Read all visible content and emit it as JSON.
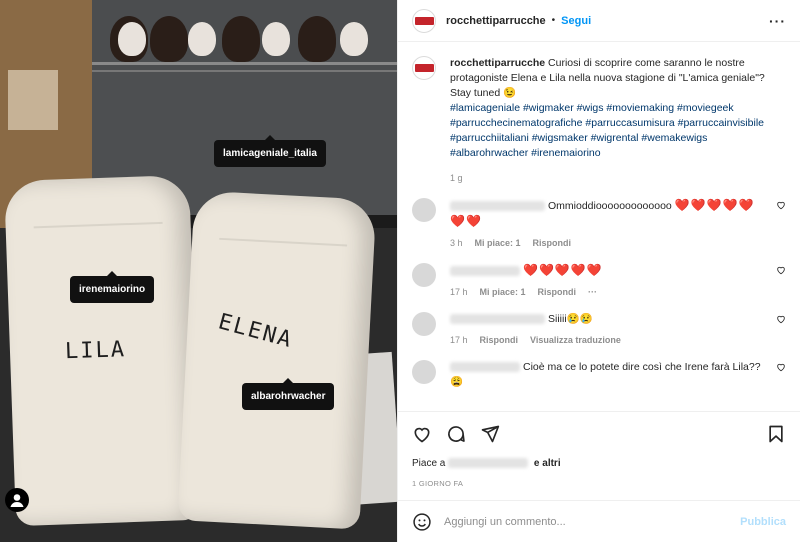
{
  "photo": {
    "tags": [
      "lamicageniale_italia",
      "irenemaiorino",
      "albarohrwacher"
    ],
    "bag_left": "LILA",
    "bag_right": "ELENA"
  },
  "header": {
    "username": "rocchettiparrucche",
    "separator": "•",
    "follow_label": "Segui",
    "more_label": "···"
  },
  "caption": {
    "username": "rocchettiparrucche",
    "text": "Curiosi di scoprire come saranno le nostre protagoniste Elena e Lila nella nuova stagione di \"L'amica geniale\"? Stay tuned 😉",
    "hashtags": "#lamicageniale #wigmaker #wigs #moviemaking #moviegeek #parrucchecinematografiche #parruccasumisura #parruccainvisibile #parrucchiitaliani #wigsmaker #wigrental #wemakewigs #albarohrwacher #irenemaiorino",
    "time": "1 g"
  },
  "comments": [
    {
      "text": "Ommioddiooooooooooooo",
      "hearts": "❤️❤️❤️❤️❤️❤️❤️",
      "time": "3 h",
      "likes": "Mi piace: 1",
      "reply": "Rispondi",
      "translate": ""
    },
    {
      "text": "",
      "hearts": "❤️❤️❤️❤️❤️",
      "time": "17 h",
      "likes": "Mi piace: 1",
      "reply": "Rispondi",
      "translate": ""
    },
    {
      "text": "Siiiii😢😢",
      "hearts": "",
      "time": "17 h",
      "likes": "",
      "reply": "Rispondi",
      "translate": "Visualizza traduzione"
    },
    {
      "text": "Cioè ma ce lo potete dire così che Irene farà Lila?? 😩",
      "hearts": "",
      "time": "",
      "likes": "",
      "reply": "",
      "translate": ""
    }
  ],
  "actions": {
    "likes_prefix": "Piace a",
    "likes_suffix": "e altri",
    "posted_ago": "1 GIORNO FA"
  },
  "add_comment": {
    "placeholder": "Aggiungi un commento...",
    "publish_label": "Pubblica"
  },
  "colors": {
    "accent": "#0095f6",
    "heart": "#e0245e",
    "hashtag": "#00376b",
    "muted": "#8e8e8e"
  },
  "icons": [
    "heart-icon",
    "comment-icon",
    "share-icon",
    "bookmark-icon",
    "emoji-icon",
    "more-icon",
    "user-tag-icon"
  ]
}
